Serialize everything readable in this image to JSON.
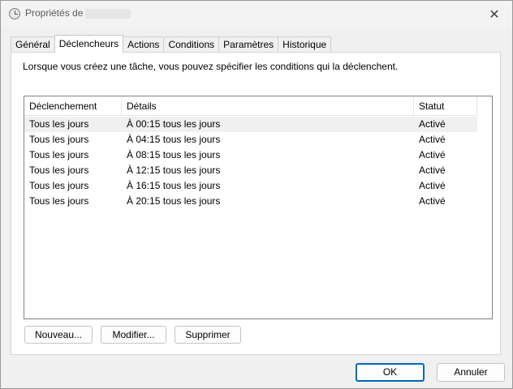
{
  "window": {
    "title": "Propriétés de",
    "title_icon": "clock-icon",
    "close_icon": "close-icon",
    "close_glyph": "✕"
  },
  "tabs": [
    {
      "label": "Général",
      "active": false
    },
    {
      "label": "Déclencheurs",
      "active": true
    },
    {
      "label": "Actions",
      "active": false
    },
    {
      "label": "Conditions",
      "active": false
    },
    {
      "label": "Paramètres",
      "active": false
    },
    {
      "label": "Historique",
      "active": false
    }
  ],
  "panel": {
    "description": "Lorsque vous créez une tâche, vous pouvez spécifier les conditions qui la déclenchent."
  },
  "triggers": {
    "columns": [
      "Déclenchement",
      "Détails",
      "Statut"
    ],
    "rows": [
      {
        "trigger": "Tous les jours",
        "details": "À 00:15 tous les jours",
        "status": "Activé"
      },
      {
        "trigger": "Tous les jours",
        "details": "À 04:15 tous les jours",
        "status": "Activé"
      },
      {
        "trigger": "Tous les jours",
        "details": "À 08:15 tous les jours",
        "status": "Activé"
      },
      {
        "trigger": "Tous les jours",
        "details": "À 12:15 tous les jours",
        "status": "Activé"
      },
      {
        "trigger": "Tous les jours",
        "details": "À 16:15 tous les jours",
        "status": "Activé"
      },
      {
        "trigger": "Tous les jours",
        "details": "À 20:15 tous les jours",
        "status": "Activé"
      }
    ]
  },
  "buttons": {
    "new": "Nouveau...",
    "edit": "Modifier...",
    "delete": "Supprimer",
    "ok": "OK",
    "cancel": "Annuler"
  },
  "colors": {
    "accent": "#0067c0",
    "selected_row": "#f0f0f0"
  }
}
